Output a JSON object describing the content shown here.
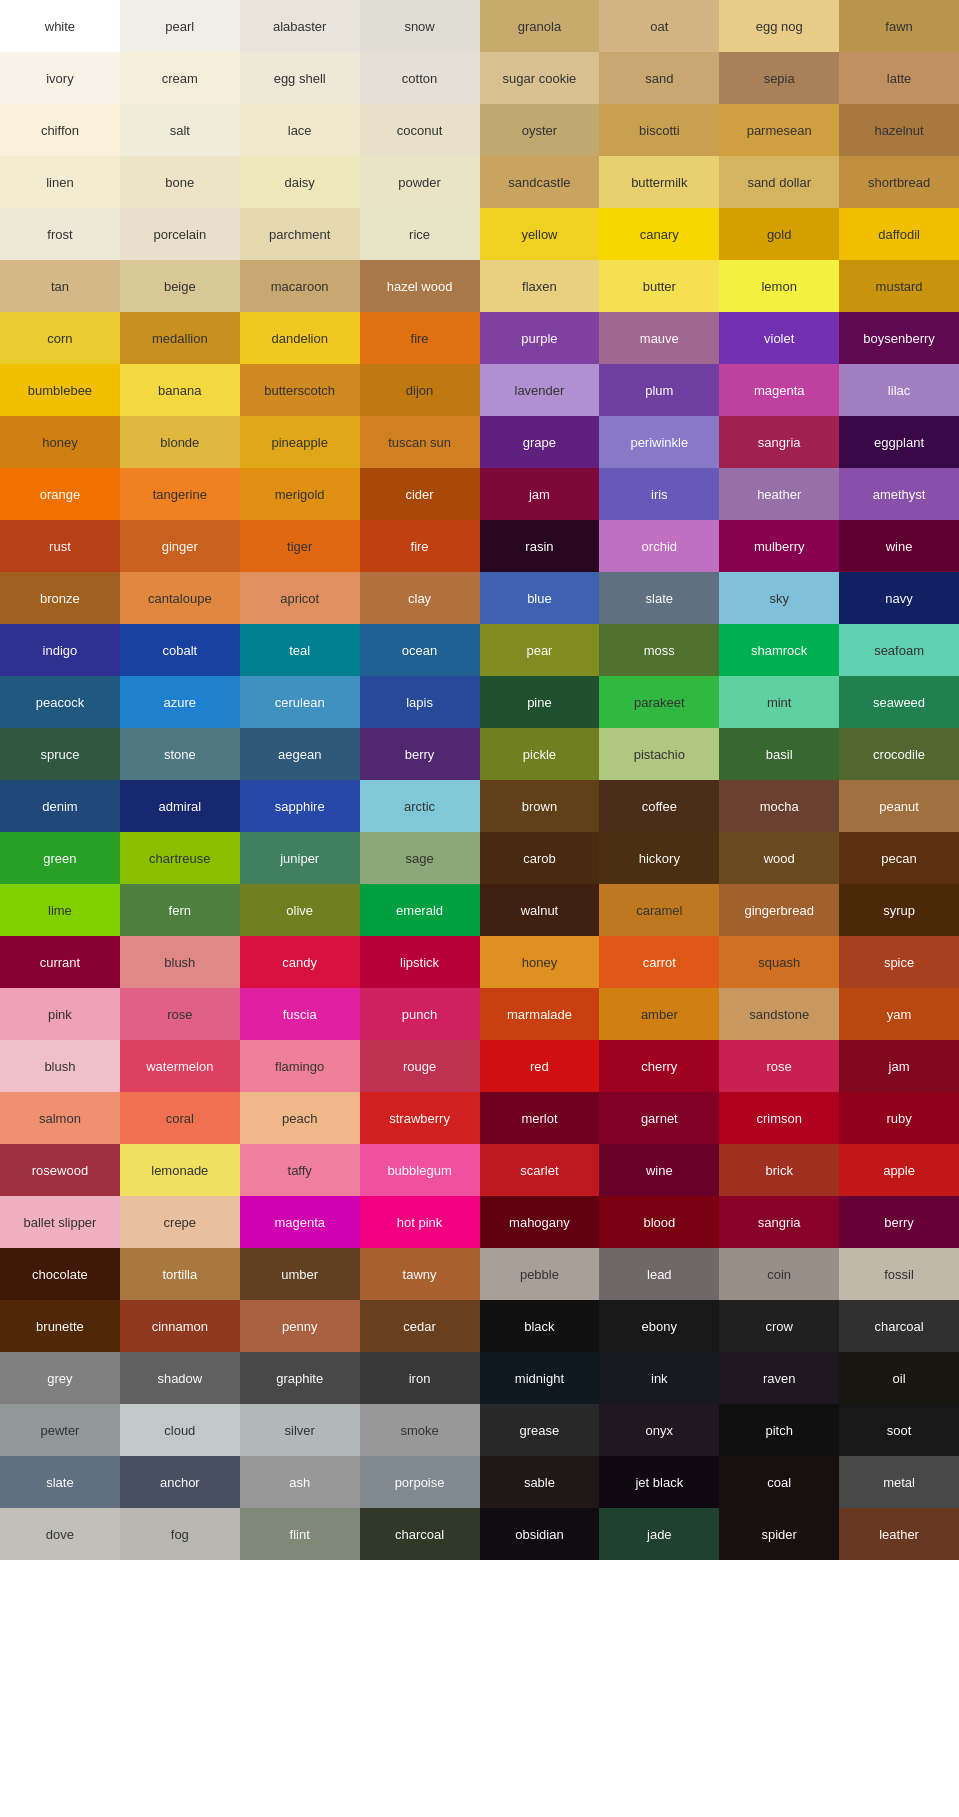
{
  "colors": [
    {
      "name": "white",
      "bg": "#FFFFFF",
      "fg": "#333333"
    },
    {
      "name": "pearl",
      "bg": "#F0EDE8",
      "fg": "#333333"
    },
    {
      "name": "alabaster",
      "bg": "#E8E4DC",
      "fg": "#333333"
    },
    {
      "name": "snow",
      "bg": "#E0DDD5",
      "fg": "#333333"
    },
    {
      "name": "granola",
      "bg": "#C8A96E",
      "fg": "#333333"
    },
    {
      "name": "oat",
      "bg": "#D4B483",
      "fg": "#333333"
    },
    {
      "name": "egg nog",
      "bg": "#E8CC88",
      "fg": "#333333"
    },
    {
      "name": "fawn",
      "bg": "#B8954A",
      "fg": "#333333"
    },
    {
      "name": "ivory",
      "bg": "#F8F4E8",
      "fg": "#333333"
    },
    {
      "name": "cream",
      "bg": "#F4EDD8",
      "fg": "#333333"
    },
    {
      "name": "egg shell",
      "bg": "#EDE8D8",
      "fg": "#333333"
    },
    {
      "name": "cotton",
      "bg": "#E4E0D8",
      "fg": "#333333"
    },
    {
      "name": "sugar cookie",
      "bg": "#D8C090",
      "fg": "#333333"
    },
    {
      "name": "sand",
      "bg": "#C8A870",
      "fg": "#333333"
    },
    {
      "name": "sepia",
      "bg": "#A8805A",
      "fg": "#333333"
    },
    {
      "name": "latte",
      "bg": "#C09060",
      "fg": "#333333"
    },
    {
      "name": "chiffon",
      "bg": "#F8F0D8",
      "fg": "#333333"
    },
    {
      "name": "salt",
      "bg": "#F0ECDC",
      "fg": "#333333"
    },
    {
      "name": "lace",
      "bg": "#F0E8CC",
      "fg": "#333333"
    },
    {
      "name": "coconut",
      "bg": "#E8E0C8",
      "fg": "#333333"
    },
    {
      "name": "oyster",
      "bg": "#C0A870",
      "fg": "#333333"
    },
    {
      "name": "biscotti",
      "bg": "#C8A050",
      "fg": "#333333"
    },
    {
      "name": "parmesean",
      "bg": "#D0A040",
      "fg": "#333333"
    },
    {
      "name": "hazelnut",
      "bg": "#A87840",
      "fg": "#333333"
    },
    {
      "name": "linen",
      "bg": "#F4ECD0",
      "fg": "#333333"
    },
    {
      "name": "bone",
      "bg": "#EDE4C8",
      "fg": "#333333"
    },
    {
      "name": "daisy",
      "bg": "#EEE8BC",
      "fg": "#333333"
    },
    {
      "name": "powder",
      "bg": "#E8E4C4",
      "fg": "#333333"
    },
    {
      "name": "sandcastle",
      "bg": "#C8A460",
      "fg": "#333333"
    },
    {
      "name": "buttermilk",
      "bg": "#E8D070",
      "fg": "#333333"
    },
    {
      "name": "sand dollar",
      "bg": "#D4B460",
      "fg": "#333333"
    },
    {
      "name": "shortbread",
      "bg": "#C09040",
      "fg": "#333333"
    },
    {
      "name": "frost",
      "bg": "#EEE8D8",
      "fg": "#333333"
    },
    {
      "name": "porcelain",
      "bg": "#E8E0CC",
      "fg": "#333333"
    },
    {
      "name": "parchment",
      "bg": "#E4D8B0",
      "fg": "#333333"
    },
    {
      "name": "rice",
      "bg": "#E8E4C8",
      "fg": "#333333"
    },
    {
      "name": "yellow",
      "bg": "#F0D020",
      "fg": "#333333"
    },
    {
      "name": "canary",
      "bg": "#F4D800",
      "fg": "#333333"
    },
    {
      "name": "gold",
      "bg": "#D4A000",
      "fg": "#333333"
    },
    {
      "name": "daffodil",
      "bg": "#F0C000",
      "fg": "#333333"
    },
    {
      "name": "tan",
      "bg": "#D4B888",
      "fg": "#333333"
    },
    {
      "name": "beige",
      "bg": "#D8C898",
      "fg": "#333333"
    },
    {
      "name": "macaroon",
      "bg": "#C8A870",
      "fg": "#333333"
    },
    {
      "name": "hazel wood",
      "bg": "#A87848",
      "fg": "#FFFFFF"
    },
    {
      "name": "flaxen",
      "bg": "#E8D080",
      "fg": "#333333"
    },
    {
      "name": "butter",
      "bg": "#F4E050",
      "fg": "#333333"
    },
    {
      "name": "lemon",
      "bg": "#F4F040",
      "fg": "#333333"
    },
    {
      "name": "mustard",
      "bg": "#C8940C",
      "fg": "#333333"
    },
    {
      "name": "corn",
      "bg": "#E8CC30",
      "fg": "#333333"
    },
    {
      "name": "medallion",
      "bg": "#C89020",
      "fg": "#333333"
    },
    {
      "name": "dandelion",
      "bg": "#F0C820",
      "fg": "#333333"
    },
    {
      "name": "fire",
      "bg": "#E07010",
      "fg": "#333333"
    },
    {
      "name": "purple",
      "bg": "#8040A0",
      "fg": "#FFFFFF"
    },
    {
      "name": "mauve",
      "bg": "#A06890",
      "fg": "#FFFFFF"
    },
    {
      "name": "violet",
      "bg": "#7030B0",
      "fg": "#FFFFFF"
    },
    {
      "name": "boysenberry",
      "bg": "#600850",
      "fg": "#FFFFFF"
    },
    {
      "name": "bumblebee",
      "bg": "#F0C000",
      "fg": "#333333"
    },
    {
      "name": "banana",
      "bg": "#F4D840",
      "fg": "#333333"
    },
    {
      "name": "butterscotch",
      "bg": "#D08820",
      "fg": "#333333"
    },
    {
      "name": "dijon",
      "bg": "#C07810",
      "fg": "#333333"
    },
    {
      "name": "lavender",
      "bg": "#B090D0",
      "fg": "#333333"
    },
    {
      "name": "plum",
      "bg": "#7040A0",
      "fg": "#FFFFFF"
    },
    {
      "name": "magenta",
      "bg": "#C040A0",
      "fg": "#FFFFFF"
    },
    {
      "name": "lilac",
      "bg": "#A080C0",
      "fg": "#FFFFFF"
    },
    {
      "name": "honey",
      "bg": "#D08010",
      "fg": "#333333"
    },
    {
      "name": "blonde",
      "bg": "#E0B840",
      "fg": "#333333"
    },
    {
      "name": "pineapple",
      "bg": "#E0A818",
      "fg": "#333333"
    },
    {
      "name": "tuscan sun",
      "bg": "#D08020",
      "fg": "#333333"
    },
    {
      "name": "grape",
      "bg": "#602080",
      "fg": "#FFFFFF"
    },
    {
      "name": "periwinkle",
      "bg": "#8878C8",
      "fg": "#FFFFFF"
    },
    {
      "name": "sangria",
      "bg": "#A02050",
      "fg": "#FFFFFF"
    },
    {
      "name": "eggplant",
      "bg": "#380848",
      "fg": "#FFFFFF"
    },
    {
      "name": "orange",
      "bg": "#F07000",
      "fg": "#FFFFFF"
    },
    {
      "name": "tangerine",
      "bg": "#F08020",
      "fg": "#333333"
    },
    {
      "name": "merigold",
      "bg": "#E09010",
      "fg": "#333333"
    },
    {
      "name": "cider",
      "bg": "#A84808",
      "fg": "#FFFFFF"
    },
    {
      "name": "jam",
      "bg": "#800838",
      "fg": "#FFFFFF"
    },
    {
      "name": "iris",
      "bg": "#6858B8",
      "fg": "#FFFFFF"
    },
    {
      "name": "heather",
      "bg": "#9870A8",
      "fg": "#FFFFFF"
    },
    {
      "name": "amethyst",
      "bg": "#8850A8",
      "fg": "#FFFFFF"
    },
    {
      "name": "rust",
      "bg": "#B84018",
      "fg": "#FFFFFF"
    },
    {
      "name": "ginger",
      "bg": "#C86020",
      "fg": "#FFFFFF"
    },
    {
      "name": "tiger",
      "bg": "#E06810",
      "fg": "#333333"
    },
    {
      "name": "fire",
      "bg": "#C04010",
      "fg": "#FFFFFF"
    },
    {
      "name": "rasin",
      "bg": "#280820",
      "fg": "#FFFFFF"
    },
    {
      "name": "orchid",
      "bg": "#C070C0",
      "fg": "#FFFFFF"
    },
    {
      "name": "mulberry",
      "bg": "#880050",
      "fg": "#FFFFFF"
    },
    {
      "name": "wine",
      "bg": "#600030",
      "fg": "#FFFFFF"
    },
    {
      "name": "bronze",
      "bg": "#A06020",
      "fg": "#FFFFFF"
    },
    {
      "name": "cantaloupe",
      "bg": "#E08840",
      "fg": "#333333"
    },
    {
      "name": "apricot",
      "bg": "#E09060",
      "fg": "#333333"
    },
    {
      "name": "clay",
      "bg": "#B07040",
      "fg": "#FFFFFF"
    },
    {
      "name": "blue",
      "bg": "#4060B0",
      "fg": "#FFFFFF"
    },
    {
      "name": "slate",
      "bg": "#607080",
      "fg": "#FFFFFF"
    },
    {
      "name": "sky",
      "bg": "#80C0D8",
      "fg": "#333333"
    },
    {
      "name": "navy",
      "bg": "#102060",
      "fg": "#FFFFFF"
    },
    {
      "name": "indigo",
      "bg": "#303090",
      "fg": "#FFFFFF"
    },
    {
      "name": "cobalt",
      "bg": "#1840A0",
      "fg": "#FFFFFF"
    },
    {
      "name": "teal",
      "bg": "#008090",
      "fg": "#FFFFFF"
    },
    {
      "name": "ocean",
      "bg": "#206090",
      "fg": "#FFFFFF"
    },
    {
      "name": "pear",
      "bg": "#808C20",
      "fg": "#FFFFFF"
    },
    {
      "name": "moss",
      "bg": "#507030",
      "fg": "#FFFFFF"
    },
    {
      "name": "shamrock",
      "bg": "#00B050",
      "fg": "#FFFFFF"
    },
    {
      "name": "seafoam",
      "bg": "#60D0B0",
      "fg": "#333333"
    },
    {
      "name": "peacock",
      "bg": "#205880",
      "fg": "#FFFFFF"
    },
    {
      "name": "azure",
      "bg": "#2080D0",
      "fg": "#FFFFFF"
    },
    {
      "name": "cerulean",
      "bg": "#4090C0",
      "fg": "#FFFFFF"
    },
    {
      "name": "lapis",
      "bg": "#284898",
      "fg": "#FFFFFF"
    },
    {
      "name": "pine",
      "bg": "#205030",
      "fg": "#FFFFFF"
    },
    {
      "name": "parakeet",
      "bg": "#30B840",
      "fg": "#333333"
    },
    {
      "name": "mint",
      "bg": "#60D0A0",
      "fg": "#333333"
    },
    {
      "name": "seaweed",
      "bg": "#208050",
      "fg": "#FFFFFF"
    },
    {
      "name": "spruce",
      "bg": "#305840",
      "fg": "#FFFFFF"
    },
    {
      "name": "stone",
      "bg": "#507880",
      "fg": "#FFFFFF"
    },
    {
      "name": "aegean",
      "bg": "#305878",
      "fg": "#FFFFFF"
    },
    {
      "name": "berry",
      "bg": "#502870",
      "fg": "#FFFFFF"
    },
    {
      "name": "pickle",
      "bg": "#708020",
      "fg": "#FFFFFF"
    },
    {
      "name": "pistachio",
      "bg": "#B0C880",
      "fg": "#333333"
    },
    {
      "name": "basil",
      "bg": "#386830",
      "fg": "#FFFFFF"
    },
    {
      "name": "crocodile",
      "bg": "#506830",
      "fg": "#FFFFFF"
    },
    {
      "name": "denim",
      "bg": "#204878",
      "fg": "#FFFFFF"
    },
    {
      "name": "admiral",
      "bg": "#182870",
      "fg": "#FFFFFF"
    },
    {
      "name": "sapphire",
      "bg": "#2848A8",
      "fg": "#FFFFFF"
    },
    {
      "name": "arctic",
      "bg": "#80C8D8",
      "fg": "#333333"
    },
    {
      "name": "brown",
      "bg": "#604018",
      "fg": "#FFFFFF"
    },
    {
      "name": "coffee",
      "bg": "#4A2E1A",
      "fg": "#FFFFFF"
    },
    {
      "name": "mocha",
      "bg": "#6A4030",
      "fg": "#FFFFFF"
    },
    {
      "name": "peanut",
      "bg": "#A07040",
      "fg": "#FFFFFF"
    },
    {
      "name": "green",
      "bg": "#28A028",
      "fg": "#FFFFFF"
    },
    {
      "name": "chartreuse",
      "bg": "#88C000",
      "fg": "#333333"
    },
    {
      "name": "juniper",
      "bg": "#408060",
      "fg": "#FFFFFF"
    },
    {
      "name": "sage",
      "bg": "#8AA878",
      "fg": "#333333"
    },
    {
      "name": "carob",
      "bg": "#4A2A10",
      "fg": "#FFFFFF"
    },
    {
      "name": "hickory",
      "bg": "#4A3010",
      "fg": "#FFFFFF"
    },
    {
      "name": "wood",
      "bg": "#6A4820",
      "fg": "#FFFFFF"
    },
    {
      "name": "pecan",
      "bg": "#5A3010",
      "fg": "#FFFFFF"
    },
    {
      "name": "lime",
      "bg": "#80D000",
      "fg": "#333333"
    },
    {
      "name": "fern",
      "bg": "#508040",
      "fg": "#FFFFFF"
    },
    {
      "name": "olive",
      "bg": "#708020",
      "fg": "#FFFFFF"
    },
    {
      "name": "emerald",
      "bg": "#00A040",
      "fg": "#FFFFFF"
    },
    {
      "name": "walnut",
      "bg": "#402010",
      "fg": "#FFFFFF"
    },
    {
      "name": "caramel",
      "bg": "#C07820",
      "fg": "#333333"
    },
    {
      "name": "gingerbread",
      "bg": "#A06030",
      "fg": "#FFFFFF"
    },
    {
      "name": "syrup",
      "bg": "#4A2808",
      "fg": "#FFFFFF"
    },
    {
      "name": "currant",
      "bg": "#880030",
      "fg": "#FFFFFF"
    },
    {
      "name": "blush",
      "bg": "#E08888",
      "fg": "#333333"
    },
    {
      "name": "candy",
      "bg": "#D81040",
      "fg": "#FFFFFF"
    },
    {
      "name": "lipstick",
      "bg": "#B80038",
      "fg": "#FFFFFF"
    },
    {
      "name": "honey",
      "bg": "#E09020",
      "fg": "#333333"
    },
    {
      "name": "carrot",
      "bg": "#E05818",
      "fg": "#FFFFFF"
    },
    {
      "name": "squash",
      "bg": "#D07020",
      "fg": "#333333"
    },
    {
      "name": "spice",
      "bg": "#A84020",
      "fg": "#FFFFFF"
    },
    {
      "name": "pink",
      "bg": "#F0A0B8",
      "fg": "#333333"
    },
    {
      "name": "rose",
      "bg": "#E06088",
      "fg": "#333333"
    },
    {
      "name": "fuscia",
      "bg": "#E020A0",
      "fg": "#FFFFFF"
    },
    {
      "name": "punch",
      "bg": "#D02060",
      "fg": "#FFFFFF"
    },
    {
      "name": "marmalade",
      "bg": "#C84010",
      "fg": "#FFFFFF"
    },
    {
      "name": "amber",
      "bg": "#D08010",
      "fg": "#333333"
    },
    {
      "name": "sandstone",
      "bg": "#C89860",
      "fg": "#333333"
    },
    {
      "name": "yam",
      "bg": "#B84810",
      "fg": "#FFFFFF"
    },
    {
      "name": "blush",
      "bg": "#F0C0C8",
      "fg": "#333333"
    },
    {
      "name": "watermelon",
      "bg": "#E04060",
      "fg": "#FFFFFF"
    },
    {
      "name": "flamingo",
      "bg": "#F08098",
      "fg": "#333333"
    },
    {
      "name": "rouge",
      "bg": "#C03050",
      "fg": "#FFFFFF"
    },
    {
      "name": "red",
      "bg": "#D01010",
      "fg": "#FFFFFF"
    },
    {
      "name": "cherry",
      "bg": "#A00020",
      "fg": "#FFFFFF"
    },
    {
      "name": "rose",
      "bg": "#C82050",
      "fg": "#FFFFFF"
    },
    {
      "name": "jam",
      "bg": "#800820",
      "fg": "#FFFFFF"
    },
    {
      "name": "salmon",
      "bg": "#F09070",
      "fg": "#333333"
    },
    {
      "name": "coral",
      "bg": "#F07050",
      "fg": "#333333"
    },
    {
      "name": "peach",
      "bg": "#F0B888",
      "fg": "#333333"
    },
    {
      "name": "strawberry",
      "bg": "#D02020",
      "fg": "#FFFFFF"
    },
    {
      "name": "merlot",
      "bg": "#700020",
      "fg": "#FFFFFF"
    },
    {
      "name": "garnet",
      "bg": "#800028",
      "fg": "#FFFFFF"
    },
    {
      "name": "crimson",
      "bg": "#B00020",
      "fg": "#FFFFFF"
    },
    {
      "name": "ruby",
      "bg": "#900018",
      "fg": "#FFFFFF"
    },
    {
      "name": "rosewood",
      "bg": "#A03040",
      "fg": "#FFFFFF"
    },
    {
      "name": "lemonade",
      "bg": "#F0E060",
      "fg": "#333333"
    },
    {
      "name": "taffy",
      "bg": "#F080A0",
      "fg": "#333333"
    },
    {
      "name": "bubblegum",
      "bg": "#F050A0",
      "fg": "#FFFFFF"
    },
    {
      "name": "scarlet",
      "bg": "#C01820",
      "fg": "#FFFFFF"
    },
    {
      "name": "wine",
      "bg": "#680028",
      "fg": "#FFFFFF"
    },
    {
      "name": "brick",
      "bg": "#A03020",
      "fg": "#FFFFFF"
    },
    {
      "name": "apple",
      "bg": "#C01818",
      "fg": "#FFFFFF"
    },
    {
      "name": "ballet slipper",
      "bg": "#F0B0C0",
      "fg": "#333333"
    },
    {
      "name": "crepe",
      "bg": "#E8C0A0",
      "fg": "#333333"
    },
    {
      "name": "magenta",
      "bg": "#D000B0",
      "fg": "#FFFFFF"
    },
    {
      "name": "hot pink",
      "bg": "#F00080",
      "fg": "#FFFFFF"
    },
    {
      "name": "mahogany",
      "bg": "#600010",
      "fg": "#FFFFFF"
    },
    {
      "name": "blood",
      "bg": "#780010",
      "fg": "#FFFFFF"
    },
    {
      "name": "sangria",
      "bg": "#880028",
      "fg": "#FFFFFF"
    },
    {
      "name": "berry",
      "bg": "#680038",
      "fg": "#FFFFFF"
    },
    {
      "name": "chocolate",
      "bg": "#401808",
      "fg": "#FFFFFF"
    },
    {
      "name": "tortilla",
      "bg": "#A87840",
      "fg": "#FFFFFF"
    },
    {
      "name": "umber",
      "bg": "#604020",
      "fg": "#FFFFFF"
    },
    {
      "name": "tawny",
      "bg": "#A86030",
      "fg": "#FFFFFF"
    },
    {
      "name": "pebble",
      "bg": "#A8A098",
      "fg": "#333333"
    },
    {
      "name": "lead",
      "bg": "#706868",
      "fg": "#FFFFFF"
    },
    {
      "name": "coin",
      "bg": "#989088",
      "fg": "#333333"
    },
    {
      "name": "fossil",
      "bg": "#C0B8A8",
      "fg": "#333333"
    },
    {
      "name": "brunette",
      "bg": "#502808",
      "fg": "#FFFFFF"
    },
    {
      "name": "cinnamon",
      "bg": "#903820",
      "fg": "#FFFFFF"
    },
    {
      "name": "penny",
      "bg": "#A86040",
      "fg": "#FFFFFF"
    },
    {
      "name": "cedar",
      "bg": "#684020",
      "fg": "#FFFFFF"
    },
    {
      "name": "black",
      "bg": "#101010",
      "fg": "#FFFFFF"
    },
    {
      "name": "ebony",
      "bg": "#181818",
      "fg": "#FFFFFF"
    },
    {
      "name": "crow",
      "bg": "#202020",
      "fg": "#FFFFFF"
    },
    {
      "name": "charcoal",
      "bg": "#303030",
      "fg": "#FFFFFF"
    },
    {
      "name": "grey",
      "bg": "#808080",
      "fg": "#FFFFFF"
    },
    {
      "name": "shadow",
      "bg": "#606060",
      "fg": "#FFFFFF"
    },
    {
      "name": "graphite",
      "bg": "#484848",
      "fg": "#FFFFFF"
    },
    {
      "name": "iron",
      "bg": "#383838",
      "fg": "#FFFFFF"
    },
    {
      "name": "midnight",
      "bg": "#101820",
      "fg": "#FFFFFF"
    },
    {
      "name": "ink",
      "bg": "#181820",
      "fg": "#FFFFFF"
    },
    {
      "name": "raven",
      "bg": "#201820",
      "fg": "#FFFFFF"
    },
    {
      "name": "oil",
      "bg": "#181810",
      "fg": "#FFFFFF"
    },
    {
      "name": "pewter",
      "bg": "#909898",
      "fg": "#333333"
    },
    {
      "name": "cloud",
      "bg": "#C0C8C8",
      "fg": "#333333"
    },
    {
      "name": "silver",
      "bg": "#B0B8B8",
      "fg": "#333333"
    },
    {
      "name": "smoke",
      "bg": "#989898",
      "fg": "#333333"
    },
    {
      "name": "grease",
      "bg": "#282828",
      "fg": "#FFFFFF"
    },
    {
      "name": "onyx",
      "bg": "#201820",
      "fg": "#FFFFFF"
    },
    {
      "name": "pitch",
      "bg": "#101010",
      "fg": "#FFFFFF"
    },
    {
      "name": "soot",
      "bg": "#181818",
      "fg": "#FFFFFF"
    },
    {
      "name": "slate",
      "bg": "#607080",
      "fg": "#FFFFFF"
    },
    {
      "name": "anchor",
      "bg": "#485060",
      "fg": "#FFFFFF"
    },
    {
      "name": "ash",
      "bg": "#989898",
      "fg": "#FFFFFF"
    },
    {
      "name": "porpoise",
      "bg": "#808890",
      "fg": "#FFFFFF"
    },
    {
      "name": "sable",
      "bg": "#201818",
      "fg": "#FFFFFF"
    },
    {
      "name": "jet black",
      "bg": "#100810",
      "fg": "#FFFFFF"
    },
    {
      "name": "coal",
      "bg": "#181010",
      "fg": "#FFFFFF"
    },
    {
      "name": "metal",
      "bg": "#484848",
      "fg": "#FFFFFF"
    },
    {
      "name": "dove",
      "bg": "#C0C0B8",
      "fg": "#333333"
    },
    {
      "name": "fog",
      "bg": "#B8B8B0",
      "fg": "#333333"
    },
    {
      "name": "flint",
      "bg": "#808878",
      "fg": "#FFFFFF"
    },
    {
      "name": "charcoal",
      "bg": "#303828",
      "fg": "#FFFFFF"
    },
    {
      "name": "obsidian",
      "bg": "#100C10",
      "fg": "#FFFFFF"
    },
    {
      "name": "jade",
      "bg": "#204030",
      "fg": "#FFFFFF"
    },
    {
      "name": "spider",
      "bg": "#181010",
      "fg": "#FFFFFF"
    },
    {
      "name": "leather",
      "bg": "#683820",
      "fg": "#FFFFFF"
    }
  ]
}
